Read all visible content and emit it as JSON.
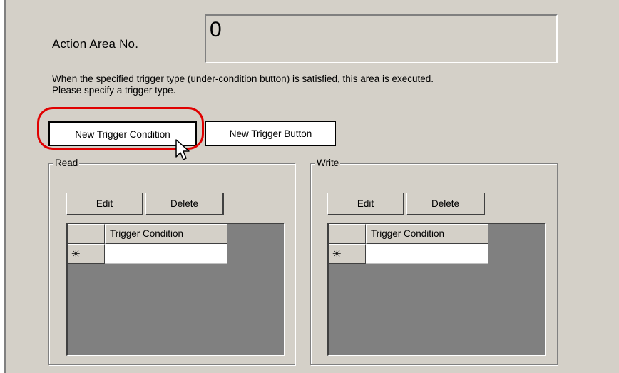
{
  "action_area": {
    "label": "Action Area No.",
    "value": "0"
  },
  "description": {
    "line1": "When the specified trigger type (under-condition button) is satisfied, this area is executed.",
    "line2": "Please specify a trigger type."
  },
  "buttons": {
    "new_trigger_condition": "New Trigger Condition",
    "new_trigger_button": "New Trigger Button"
  },
  "read_group": {
    "legend": "Read",
    "edit": "Edit",
    "delete": "Delete",
    "column_header": "Trigger Condition",
    "new_row_marker": "✳"
  },
  "write_group": {
    "legend": "Write",
    "edit": "Edit",
    "delete": "Delete",
    "column_header": "Trigger Condition",
    "new_row_marker": "✳"
  },
  "colors": {
    "highlight": "#e00000",
    "dialog_bg": "#d4d0c8",
    "grid_bg": "#808080"
  }
}
